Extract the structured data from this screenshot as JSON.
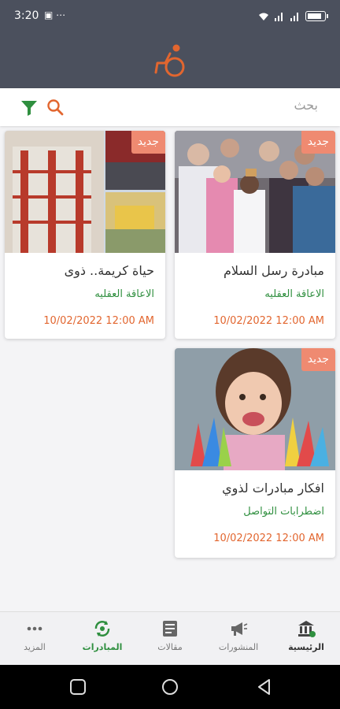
{
  "status": {
    "time": "3:20",
    "extra_icons": "▣ ⋯"
  },
  "search": {
    "placeholder": "بحث"
  },
  "cards": [
    {
      "badge": "جديد",
      "title": "مبادرة رسل السلام",
      "category": "الاعاقة العقليه",
      "date": "10/02/2022 12:00 AM"
    },
    {
      "badge": "جديد",
      "title": "حياة كريمة.. ذوى",
      "category": "الاعاقة العقليه",
      "date": "10/02/2022 12:00 AM"
    },
    {
      "badge": "جديد",
      "title": "افكار مبادرات لذوي",
      "category": "اضطرابات التواصل",
      "date": "10/02/2022 12:00 AM"
    }
  ],
  "nav": {
    "home": "الرئيسية",
    "posts": "المنشورات",
    "articles": "مقالات",
    "initiatives": "المبادرات",
    "more": "المزيد"
  },
  "colors": {
    "header": "#4b505d",
    "accent_orange": "#e2662f",
    "accent_green": "#2f8f3f",
    "badge": "#ef8a71"
  }
}
